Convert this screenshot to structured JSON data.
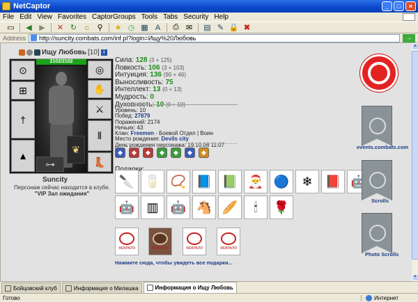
{
  "window": {
    "title": "NetCaptor"
  },
  "menu": [
    "File",
    "Edit",
    "View",
    "Favorites",
    "CaptorGroups",
    "Tools",
    "Tabs",
    "Security",
    "Help"
  ],
  "toolbar": {
    "icons": [
      "new-page-icon",
      "back-icon",
      "forward-icon",
      "stop-icon",
      "refresh-icon",
      "home-icon",
      "search-icon",
      "favorites-star-icon",
      "history-icon",
      "view-icon",
      "font-size-icon",
      "print-icon",
      "mail-icon",
      "page-icon",
      "edit-icon",
      "lock-icon",
      "close-x-icon"
    ]
  },
  "address": {
    "label": "Address",
    "url": "http://suncity.combats.com/inf.pl?login=Ищу%20Любовь"
  },
  "character": {
    "name": "Ищу Любовь",
    "level": "[10]",
    "hp": "2102/2102",
    "nick": "Suncity",
    "club_status": "Персонаж сейчас находится в клубе.",
    "club_room": "\"VIP Зал ожидания\""
  },
  "stats": [
    {
      "label": "Сила:",
      "value": "128",
      "bonus": "(3 + 125)"
    },
    {
      "label": "Ловкость:",
      "value": "106",
      "bonus": "(3 + 103)"
    },
    {
      "label": "Интуиция:",
      "value": "136",
      "bonus": "(90 + 46)"
    },
    {
      "label": "Выносливость:",
      "value": "75",
      "bonus": ""
    },
    {
      "label": "Интеллект:",
      "value": "13",
      "bonus": "(0 + 13)"
    },
    {
      "label": "Мудрость:",
      "value": "0",
      "bonus": ""
    },
    {
      "label": "Духовность:",
      "value": "10",
      "bonus": "(0 + 10)"
    }
  ],
  "info": {
    "level_line": "Уровень: 10",
    "wins_label": "Побед:",
    "wins": "27879",
    "losses_line": "Поражений: 2174",
    "draws_line": "Ничьих: 43",
    "clan_label": "Клан:",
    "clan": "Freemen",
    "clan_dept": " - Боевой Отдел | Воин",
    "birthplace_label": "Место рождения:",
    "birthplace": "Devils city",
    "birthday_line": "День рождения персонажа: 19.10.06 11:07"
  },
  "badges": [
    "blue",
    "red",
    "red",
    "green",
    "green",
    "blue",
    "orange"
  ],
  "gifts": {
    "label": "Подарки:",
    "row1": [
      "knife",
      "glass",
      "bracelet",
      "book",
      "book-dark",
      "hat",
      "ball",
      "snowflake",
      "box-red",
      "robot"
    ],
    "row2": [
      "robot-grey",
      "comb",
      "robot-head",
      "rocking-horse",
      "rolling-pin",
      "candle",
      "christmas-bouquet"
    ],
    "card_text": "ФЕВРАЛЯ",
    "see_all": "Нажмите сюда, чтобы увидеть все подарки..."
  },
  "right": {
    "events_label": "events.combats.com",
    "scrolls_label": "Scrolls",
    "photo_label": "Photo Scrolls"
  },
  "tabs": [
    {
      "label": "Бойцовский клуб",
      "active": false
    },
    {
      "label": "Информация о Милашка",
      "active": false
    },
    {
      "label": "Информация о Ищу Любовь",
      "active": true
    }
  ],
  "status": {
    "left": "Готово",
    "zone": "Интернет"
  },
  "colors": {
    "title_bar": "#0a48c8",
    "stat_value": "#1d8b1d",
    "link": "#1b3c87",
    "logo_red": "#e32222"
  }
}
